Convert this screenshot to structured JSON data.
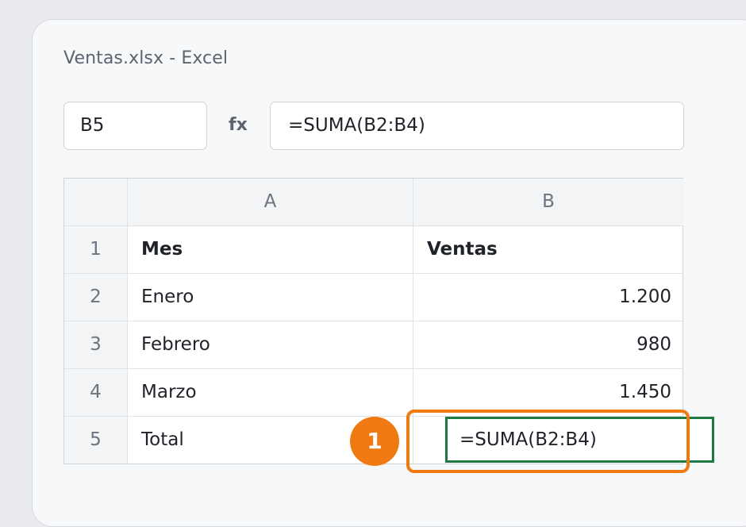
{
  "window": {
    "title": "Ventas.xlsx - Excel"
  },
  "formula_bar": {
    "name_box": "B5",
    "fx_label": "fx",
    "formula": "=SUMA(B2:B4)"
  },
  "sheet": {
    "columns": [
      "A",
      "B"
    ],
    "rows": [
      {
        "num": "1",
        "a": "Mes",
        "b": "Ventas"
      },
      {
        "num": "2",
        "a": "Enero",
        "b": "1.200"
      },
      {
        "num": "3",
        "a": "Febrero",
        "b": "980"
      },
      {
        "num": "4",
        "a": "Marzo",
        "b": "1.450"
      },
      {
        "num": "5",
        "a": "Total",
        "b": "=SUMA(B2:B4)"
      }
    ]
  },
  "callout": {
    "badge": "1",
    "color": "#f07a12"
  },
  "colors": {
    "selection_border": "#1e7a45",
    "highlight": "#f07a12"
  }
}
